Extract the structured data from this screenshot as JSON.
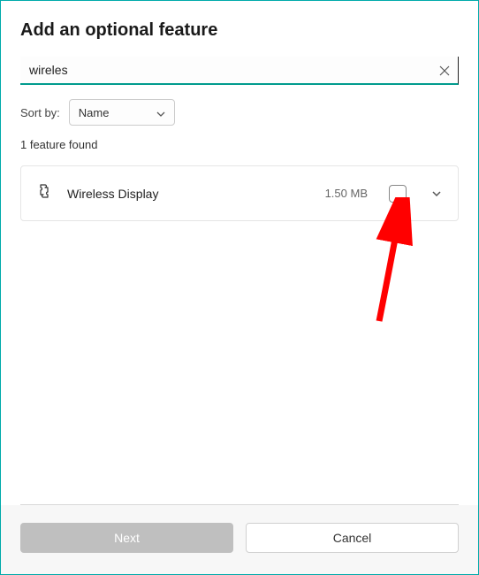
{
  "dialog": {
    "title": "Add an optional feature"
  },
  "search": {
    "value": "wireles",
    "placeholder": ""
  },
  "sort": {
    "label": "Sort by:",
    "selected": "Name"
  },
  "results": {
    "count_text": "1 feature found"
  },
  "features": [
    {
      "name": "Wireless Display",
      "size": "1.50 MB",
      "checked": false
    }
  ],
  "buttons": {
    "next": "Next",
    "cancel": "Cancel"
  }
}
